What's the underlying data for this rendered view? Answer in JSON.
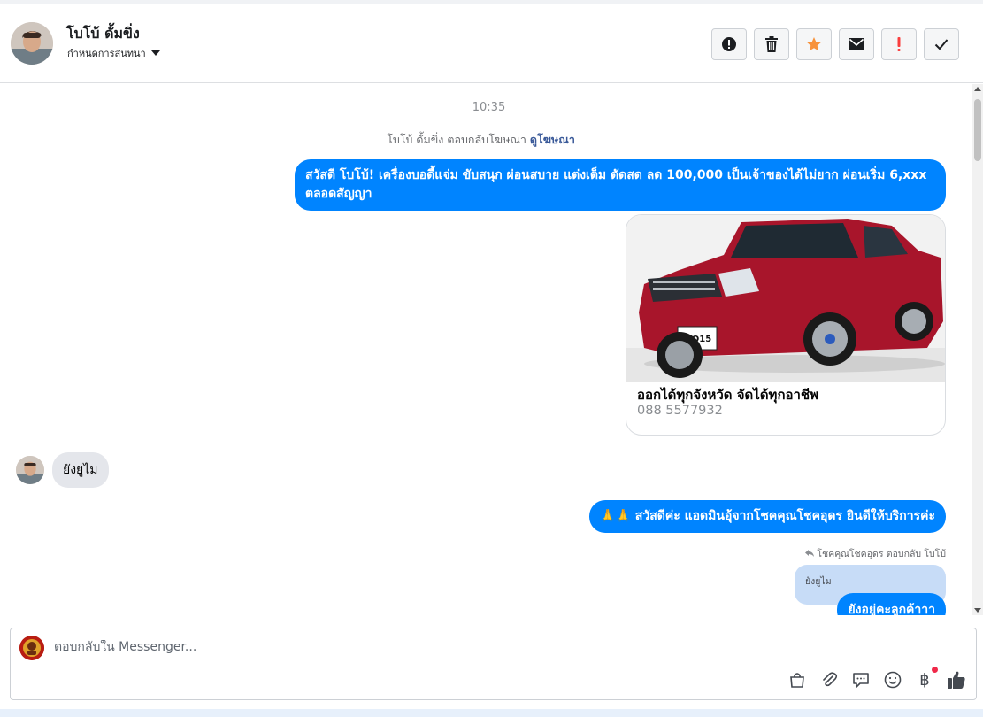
{
  "header": {
    "name": "โบโบ้ ดั้มขิ่ง",
    "assign_label": "กำหนดการสนทนา",
    "actions": [
      {
        "name": "mark-spam-button",
        "icon": "alert-circle-icon"
      },
      {
        "name": "delete-button",
        "icon": "trash-icon"
      },
      {
        "name": "star-button",
        "icon": "star-icon",
        "color": "#f7923b"
      },
      {
        "name": "mark-unread-button",
        "icon": "envelope-icon"
      },
      {
        "name": "follow-up-button",
        "icon": "exclamation-icon",
        "color": "#fa3e3e"
      },
      {
        "name": "mark-done-button",
        "icon": "check-icon"
      }
    ]
  },
  "thread": {
    "time": "10:35",
    "ad_reply_text": "โบโบ้ ดั้มขิ่ง ตอบกลับโฆษณา",
    "ad_link": "ดูโฆษณา",
    "message1": "สวัสดี โบโบ้! เครื่องบอดี้แจ่ม ขับสนุก ผ่อนสบาย แต่งเต็ม ตัดสด ลด 100,000 เป็นเจ้าของได้ไม่ยาก ผ่อนเริ่ม 6,xxx ตลอดสัญญา",
    "card": {
      "title": "ออกได้ทุกจังหวัด จัดได้ทุกอาชีพ",
      "subtitle": "088 5577932",
      "plate_text": "MO15"
    },
    "incoming": "ยังยูไม",
    "message2_emoji": "🙏🙏",
    "message2": "สวัสดีค่ะ แอดมินอุ้จากโชคคุณโชคอุดร ยินดีให้บริการค่ะ",
    "replied_to": "โชคคุณโชคอุดร ตอบกลับ โบโบ้",
    "quoted": "ยังยูไม",
    "message3": "ยังอยู่คะลูกค้าาา"
  },
  "composer": {
    "placeholder": "ตอบกลับใน Messenger...",
    "tools": [
      "shopping-bag-icon",
      "paperclip-icon",
      "saved-replies-icon",
      "emoji-icon",
      "baht-icon",
      "thumbs-up-icon"
    ],
    "baht_symbol": "฿"
  },
  "colors": {
    "accent": "#0084ff",
    "star": "#f7923b",
    "alert": "#fa3e3e"
  }
}
